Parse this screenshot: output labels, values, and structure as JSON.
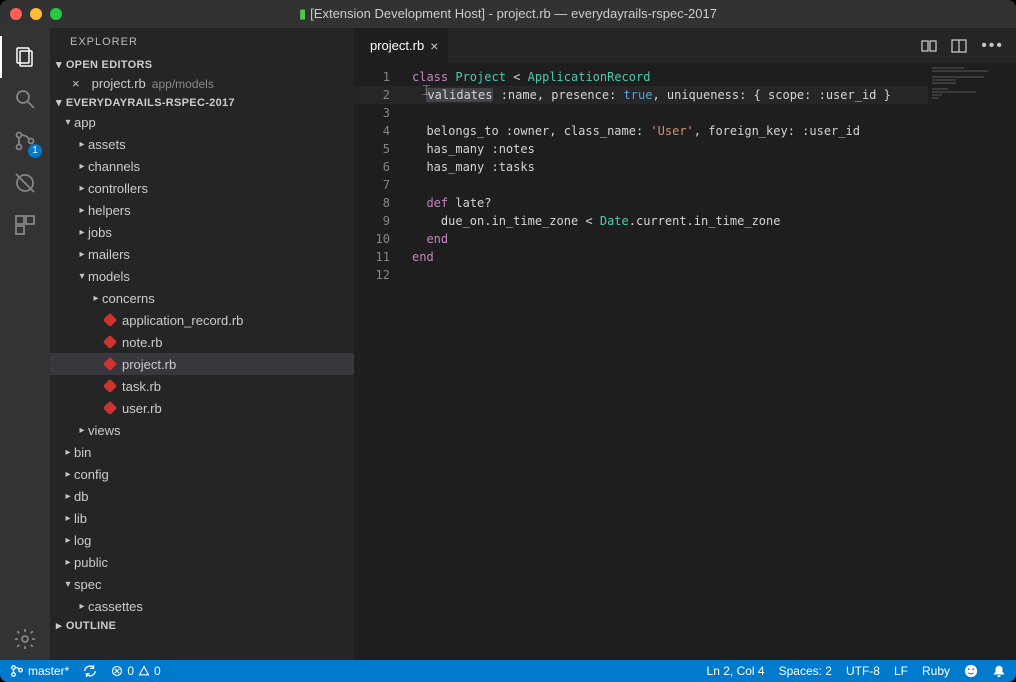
{
  "window": {
    "title": "[Extension Development Host] - project.rb — everydayrails-rspec-2017"
  },
  "explorer": {
    "title": "EXPLORER",
    "open_editors_label": "OPEN EDITORS",
    "open_editor": {
      "name": "project.rb",
      "path": "app/models"
    },
    "project_label": "EVERYDAYRAILS-RSPEC-2017",
    "outline_label": "OUTLINE"
  },
  "tree": {
    "app": "app",
    "folders1": [
      "assets",
      "channels",
      "controllers",
      "helpers",
      "jobs",
      "mailers"
    ],
    "models": "models",
    "concerns": "concerns",
    "model_files": [
      "application_record.rb",
      "note.rb",
      "project.rb",
      "task.rb",
      "user.rb"
    ],
    "views": "views",
    "folders2": [
      "bin",
      "config",
      "db",
      "lib",
      "log",
      "public"
    ],
    "spec": "spec",
    "cassettes": "cassettes"
  },
  "tab": {
    "name": "project.rb"
  },
  "scm_badge": "1",
  "code": {
    "lines": [
      "1",
      "2",
      "3",
      "4",
      "5",
      "6",
      "7",
      "8",
      "9",
      "10",
      "11",
      "12"
    ],
    "l1_class": "class",
    "l1_name": "Project",
    "l1_lt": "<",
    "l1_parent": "ApplicationRecord",
    "l2_validates": "validates",
    "l2_rest": " :name, presence: ",
    "l2_true": "true",
    "l2_rest2": ", uniqueness: { scope: :user_id }",
    "l4": "  belongs_to :owner, class_name: ",
    "l4_str": "'User'",
    "l4_rest": ", foreign_key: :user_id",
    "l5": "  has_many :notes",
    "l6": "  has_many :tasks",
    "l8_def": "def",
    "l8_name": " late?",
    "l9a": "    due_on.in_time_zone < ",
    "l9_date": "Date",
    "l9b": ".current.in_time_zone",
    "l10": "  end",
    "l11": "end"
  },
  "status": {
    "branch": "master*",
    "errors": "0",
    "warnings": "0",
    "ln_col": "Ln 2, Col 4",
    "spaces": "Spaces: 2",
    "encoding": "UTF-8",
    "eol": "LF",
    "lang": "Ruby"
  }
}
